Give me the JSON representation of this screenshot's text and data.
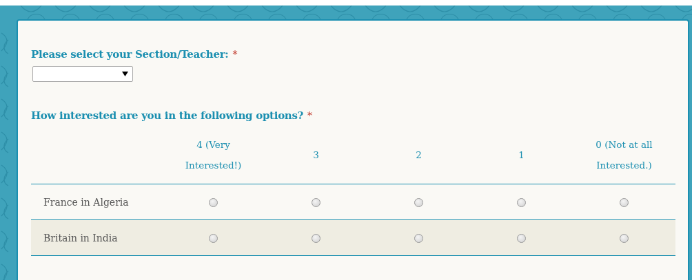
{
  "questions": [
    {
      "kind": "dropdown",
      "label": "Please select your Section/Teacher:",
      "required_mark": "*"
    },
    {
      "kind": "matrix",
      "label": "How interested are you in the following options?",
      "required_mark": "*",
      "columns": [
        "4 (Very Interested!)",
        "3",
        "2",
        "1",
        "0 (Not at all Interested.)"
      ],
      "rows": [
        {
          "label": "France in Algeria",
          "choices": [
            {
              "selected": false
            },
            {
              "selected": false
            },
            {
              "selected": false
            },
            {
              "selected": false
            },
            {
              "selected": false
            }
          ]
        },
        {
          "label": "Britain in India",
          "choices": [
            {
              "selected": false
            },
            {
              "selected": false
            },
            {
              "selected": false
            },
            {
              "selected": false
            },
            {
              "selected": false
            }
          ]
        }
      ]
    }
  ]
}
